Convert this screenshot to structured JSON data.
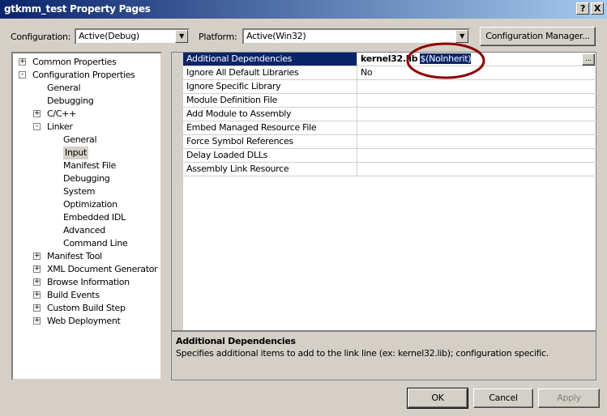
{
  "title": "gtkmm_test Property Pages",
  "titlebar": {
    "help": "?",
    "close": "X"
  },
  "configuration": {
    "label": "Configuration:",
    "value": "Active(Debug)"
  },
  "platform": {
    "label": "Platform:",
    "value": "Active(Win32)"
  },
  "config_manager": "Configuration Manager...",
  "tree": [
    {
      "label": "Common Properties",
      "level": 0,
      "expander": "+"
    },
    {
      "label": "Configuration Properties",
      "level": 0,
      "expander": "-"
    },
    {
      "label": "General",
      "level": 1
    },
    {
      "label": "Debugging",
      "level": 1
    },
    {
      "label": "C/C++",
      "level": 1,
      "expander": "+"
    },
    {
      "label": "Linker",
      "level": 1,
      "expander": "-"
    },
    {
      "label": "General",
      "level": 2
    },
    {
      "label": "Input",
      "level": 2,
      "selected": true
    },
    {
      "label": "Manifest File",
      "level": 2
    },
    {
      "label": "Debugging",
      "level": 2
    },
    {
      "label": "System",
      "level": 2
    },
    {
      "label": "Optimization",
      "level": 2
    },
    {
      "label": "Embedded IDL",
      "level": 2
    },
    {
      "label": "Advanced",
      "level": 2
    },
    {
      "label": "Command Line",
      "level": 2
    },
    {
      "label": "Manifest Tool",
      "level": 1,
      "expander": "+"
    },
    {
      "label": "XML Document Generator",
      "level": 1,
      "expander": "+"
    },
    {
      "label": "Browse Information",
      "level": 1,
      "expander": "+"
    },
    {
      "label": "Build Events",
      "level": 1,
      "expander": "+"
    },
    {
      "label": "Custom Build Step",
      "level": 1,
      "expander": "+"
    },
    {
      "label": "Web Deployment",
      "level": 1,
      "expander": "+"
    }
  ],
  "properties": [
    {
      "name": "Additional Dependencies",
      "value": "kernel32.lib",
      "value_selected": "$(NoInherit)",
      "ellipsis": "..."
    },
    {
      "name": "Ignore All Default Libraries",
      "value": "No"
    },
    {
      "name": "Ignore Specific Library",
      "value": ""
    },
    {
      "name": "Module Definition File",
      "value": ""
    },
    {
      "name": "Add Module to Assembly",
      "value": ""
    },
    {
      "name": "Embed Managed Resource File",
      "value": ""
    },
    {
      "name": "Force Symbol References",
      "value": ""
    },
    {
      "name": "Delay Loaded DLLs",
      "value": ""
    },
    {
      "name": "Assembly Link Resource",
      "value": ""
    }
  ],
  "description": {
    "title": "Additional Dependencies",
    "text": "Specifies additional items to add to the link line (ex: kernel32.lib); configuration specific."
  },
  "buttons": {
    "ok": "OK",
    "cancel": "Cancel",
    "apply": "Apply"
  },
  "colors": {
    "selection": "#0a246a",
    "annotation": "#8b0000"
  }
}
